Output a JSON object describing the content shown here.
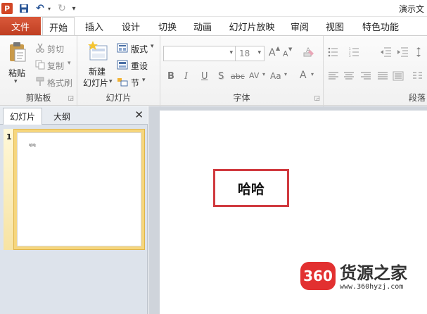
{
  "window": {
    "title": "演示文",
    "app_letter": "P"
  },
  "qat": {
    "undo": "↶",
    "redo": "↻",
    "dropdown": "▾",
    "customize": "▾"
  },
  "tabs": {
    "file": "文件",
    "items": [
      "开始",
      "插入",
      "设计",
      "切换",
      "动画",
      "幻灯片放映",
      "审阅",
      "视图",
      "特色功能"
    ]
  },
  "ribbon": {
    "clipboard": {
      "label": "剪贴板",
      "paste": "粘贴",
      "cut": "剪切",
      "copy": "复制",
      "format_painter": "格式刷"
    },
    "slides": {
      "label": "幻灯片",
      "new_slide_line1": "新建",
      "new_slide_line2": "幻灯片",
      "layout": "版式",
      "reset": "重设",
      "section": "节"
    },
    "font": {
      "label": "字体",
      "font_name": "",
      "font_size": "18",
      "bold": "B",
      "italic": "I",
      "underline": "U",
      "shadow": "S",
      "strike": "abc",
      "spacing": "AV",
      "case": "Aa",
      "color": "A",
      "grow": "A",
      "shrink": "A"
    },
    "paragraph": {
      "label": "段落"
    }
  },
  "panel": {
    "tab_slides": "幻灯片",
    "tab_outline": "大纲",
    "close": "✕",
    "slide_number": "1",
    "thumb_text": "哈哈"
  },
  "slide": {
    "text": "哈哈"
  },
  "watermark": {
    "logo": "360",
    "name": "货源之家",
    "url": "www.360hyzj.com"
  }
}
